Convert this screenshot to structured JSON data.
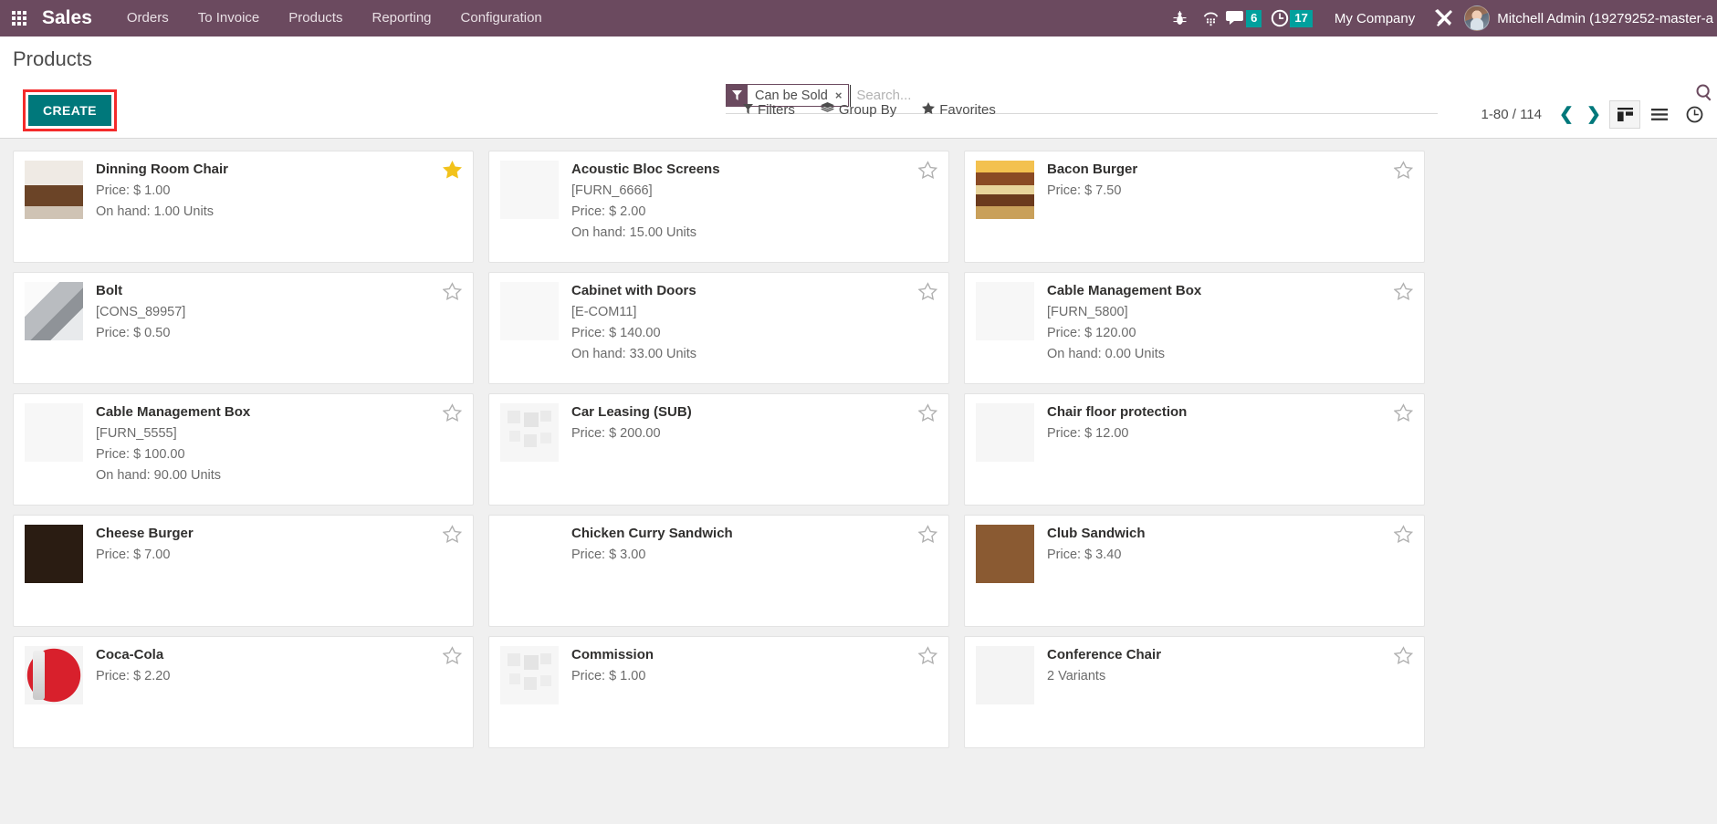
{
  "navbar": {
    "apps_icon": "apps-grid-icon",
    "brand": "Sales",
    "menu": [
      {
        "label": "Orders"
      },
      {
        "label": "To Invoice"
      },
      {
        "label": "Products"
      },
      {
        "label": "Reporting"
      },
      {
        "label": "Configuration"
      }
    ],
    "sys_icons": [
      {
        "name": "bug-icon",
        "glyph": "🐛"
      },
      {
        "name": "dialpad-icon",
        "glyph": "☎"
      }
    ],
    "messages_badge": "6",
    "activities_badge": "17",
    "company": "My Company",
    "debug_icon": "tools-icon",
    "avatar": "user-avatar",
    "user": "Mitchell Admin (19279252-master-a"
  },
  "control_panel": {
    "title": "Products",
    "create_label": "CREATE",
    "search": {
      "facet_label": "Can be Sold",
      "facet_icon": "filter-funnel-icon",
      "facet_remove": "×",
      "placeholder": "Search...",
      "value": "",
      "magnifier_icon": "search-icon"
    },
    "buttons": [
      {
        "name": "filters",
        "label": "Filters",
        "icon": "filter-icon"
      },
      {
        "name": "group-by",
        "label": "Group By",
        "icon": "layers-icon"
      },
      {
        "name": "favorites",
        "label": "Favorites",
        "icon": "star-icon"
      }
    ],
    "pager": {
      "range": "1-80 / 114",
      "prev_icon": "chevron-left-icon",
      "next_icon": "chevron-right-icon"
    },
    "views": [
      {
        "name": "kanban-view",
        "icon": "kanban-icon",
        "active": true
      },
      {
        "name": "list-view",
        "icon": "list-icon",
        "active": false
      },
      {
        "name": "activity-view",
        "icon": "clock-icon",
        "active": false
      }
    ]
  },
  "colors": {
    "navbar": "#6b4a5f",
    "accent": "#00787b",
    "badge": "#00a09d",
    "highlight": "#f42b2b",
    "favorite_star": "#f2c21b"
  },
  "products": [
    {
      "name": "Dinning Room Chair",
      "code": "",
      "price": "Price: $ 1.00",
      "onhand": "On hand: 1.00 Units",
      "variants": "",
      "favorite": true,
      "img": "img-dining"
    },
    {
      "name": "Acoustic Bloc Screens",
      "code": "[FURN_6666]",
      "price": "Price: $ 2.00",
      "onhand": "On hand: 15.00 Units",
      "variants": "",
      "favorite": false,
      "img": "img-acoustic"
    },
    {
      "name": "Bacon Burger",
      "code": "",
      "price": "Price: $ 7.50",
      "onhand": "",
      "variants": "",
      "favorite": false,
      "img": "img-bacon"
    },
    {
      "name": "Bolt",
      "code": "[CONS_89957]",
      "price": "Price: $ 0.50",
      "onhand": "",
      "variants": "",
      "favorite": false,
      "img": "img-bolt"
    },
    {
      "name": "Cabinet with Doors",
      "code": "[E-COM11]",
      "price": "Price: $ 140.00",
      "onhand": "On hand: 33.00 Units",
      "variants": "",
      "favorite": false,
      "img": "img-cabinet"
    },
    {
      "name": "Cable Management Box",
      "code": "[FURN_5800]",
      "price": "Price: $ 120.00",
      "onhand": "On hand: 0.00 Units",
      "variants": "",
      "favorite": false,
      "img": "img-cablebox"
    },
    {
      "name": "Cable Management Box",
      "code": "[FURN_5555]",
      "price": "Price: $ 100.00",
      "onhand": "On hand: 90.00 Units",
      "variants": "",
      "favorite": false,
      "img": "img-cablebox"
    },
    {
      "name": "Car Leasing (SUB)",
      "code": "",
      "price": "Price: $ 200.00",
      "onhand": "",
      "variants": "",
      "favorite": false,
      "img": "ph"
    },
    {
      "name": "Chair floor protection",
      "code": "",
      "price": "Price: $ 12.00",
      "onhand": "",
      "variants": "",
      "favorite": false,
      "img": "img-chairfloor"
    },
    {
      "name": "Cheese Burger",
      "code": "",
      "price": "Price: $ 7.00",
      "onhand": "",
      "variants": "",
      "favorite": false,
      "img": "img-cheese"
    },
    {
      "name": "Chicken Curry Sandwich",
      "code": "",
      "price": "Price: $ 3.00",
      "onhand": "",
      "variants": "",
      "favorite": false,
      "img": "img-chicken"
    },
    {
      "name": "Club Sandwich",
      "code": "",
      "price": "Price: $ 3.40",
      "onhand": "",
      "variants": "",
      "favorite": false,
      "img": "img-club"
    },
    {
      "name": "Coca-Cola",
      "code": "",
      "price": "Price: $ 2.20",
      "onhand": "",
      "variants": "",
      "favorite": false,
      "img": "img-coke"
    },
    {
      "name": "Commission",
      "code": "",
      "price": "Price: $ 1.00",
      "onhand": "",
      "variants": "",
      "favorite": false,
      "img": "ph"
    },
    {
      "name": "Conference Chair",
      "code": "",
      "price": "",
      "onhand": "",
      "variants": "2 Variants",
      "favorite": false,
      "img": "img-confchair"
    }
  ]
}
